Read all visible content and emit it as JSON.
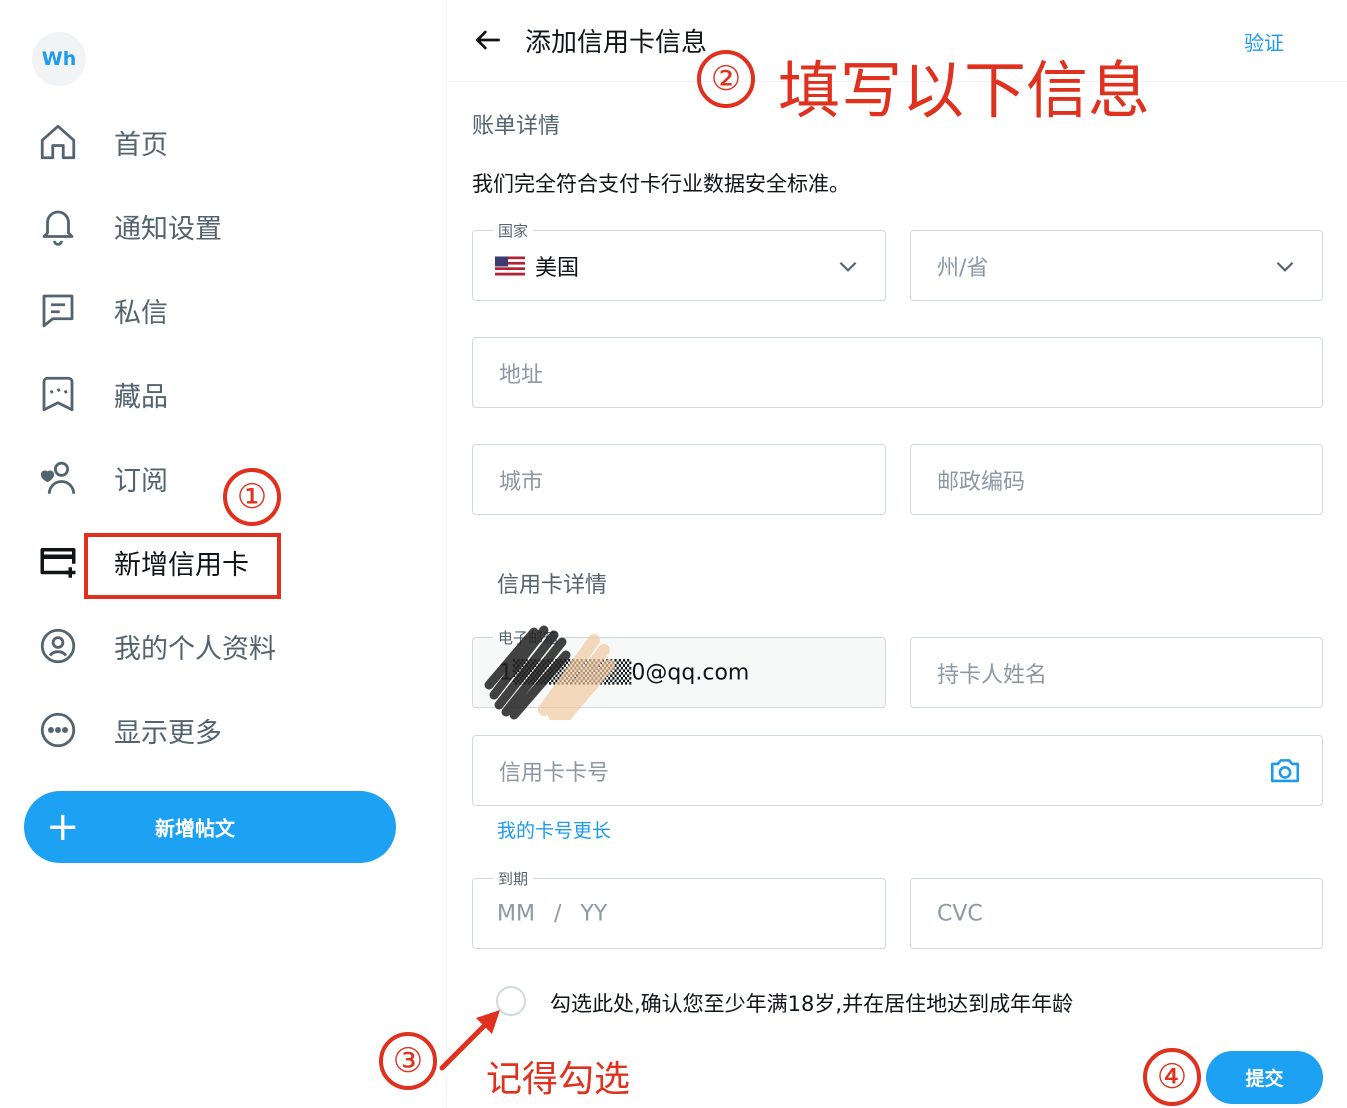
{
  "sidebar": {
    "avatar_text": "Wh",
    "items": [
      {
        "label": "首页",
        "icon": "home-icon"
      },
      {
        "label": "通知设置",
        "icon": "bell-icon"
      },
      {
        "label": "私信",
        "icon": "message-icon"
      },
      {
        "label": "藏品",
        "icon": "collectibles-icon"
      },
      {
        "label": "订阅",
        "icon": "subscriptions-icon"
      },
      {
        "label": "新增信用卡",
        "icon": "add-card-icon"
      },
      {
        "label": "我的个人资料",
        "icon": "profile-icon"
      },
      {
        "label": "显示更多",
        "icon": "more-icon"
      }
    ],
    "post_button": "新增帖文"
  },
  "header": {
    "title": "添加信用卡信息",
    "verify": "验证"
  },
  "billing": {
    "section_title": "账单详情",
    "notice": "我们完全符合支付卡行业数据安全标准。",
    "country_label": "国家",
    "country_value": "美国",
    "state_placeholder": "州/省",
    "address_placeholder": "地址",
    "city_placeholder": "城市",
    "zip_placeholder": "邮政编码"
  },
  "card": {
    "section_title": "信用卡详情",
    "email_label": "电子邮箱",
    "email_value": "1▒▒▒▒▒▒▒0@qq.com",
    "holder_placeholder": "持卡人姓名",
    "number_placeholder": "信用卡卡号",
    "longer_link": "我的卡号更长",
    "expiry_label": "到期",
    "expiry_placeholder": "MM / YY",
    "cvc_placeholder": "CVC"
  },
  "age_confirm": "勾选此处,确认您至少年满18岁,并在居住地达到成年年龄",
  "submit": "提交",
  "annotations": {
    "step1": "①",
    "step2": "②",
    "step2_text": "填写以下信息",
    "step3": "③",
    "step3_text": "记得勾选",
    "step4": "④"
  },
  "colors": {
    "accent": "#1da1f2",
    "annotation": "#e0301e"
  }
}
